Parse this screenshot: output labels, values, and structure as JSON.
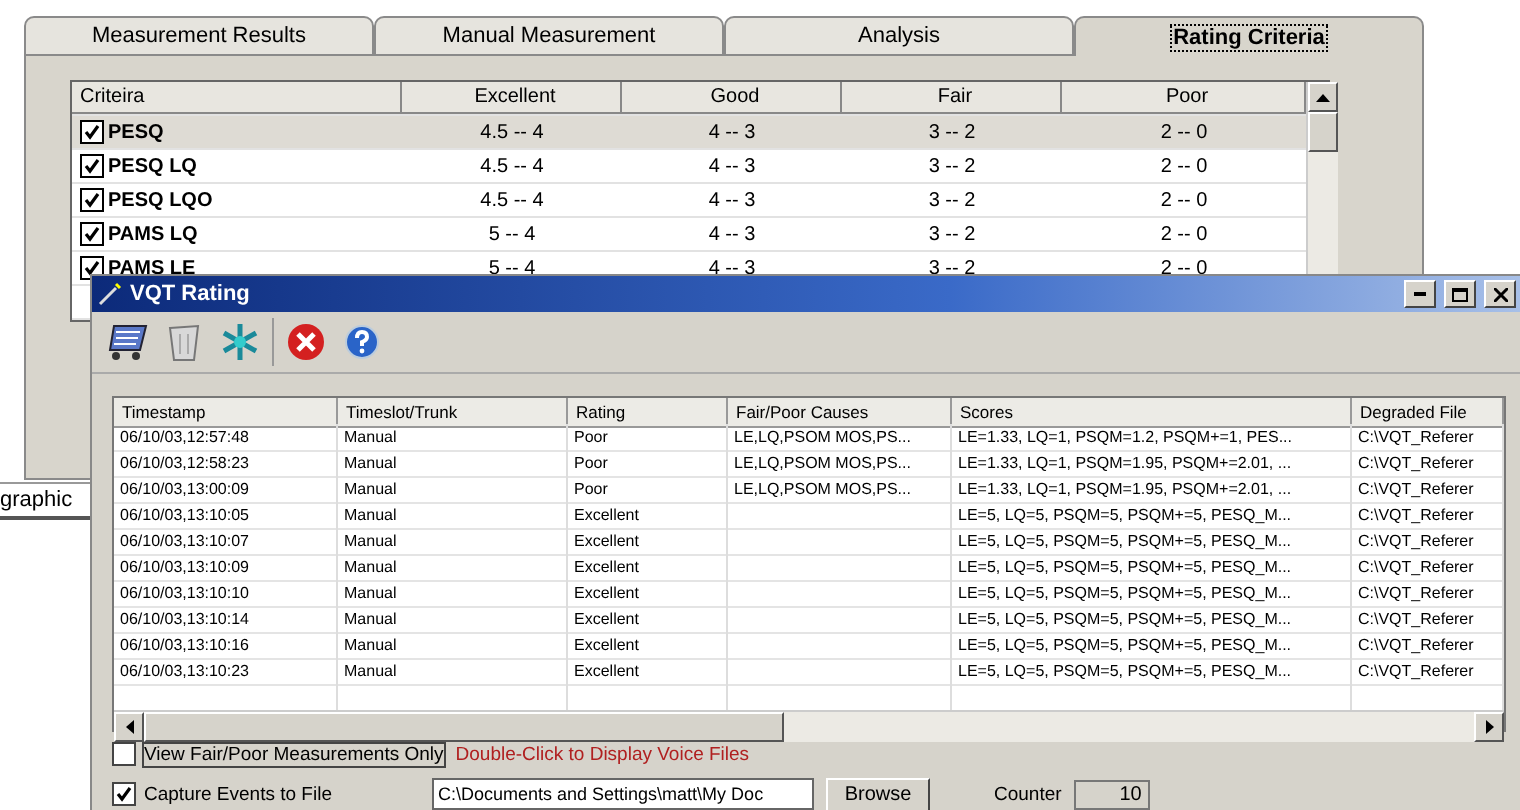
{
  "back_window": {
    "tabs": [
      {
        "label": "Measurement Results",
        "selected": false
      },
      {
        "label": "Manual Measurement",
        "selected": false
      },
      {
        "label": "Analysis",
        "selected": false
      },
      {
        "label": "Rating Criteria",
        "selected": true
      }
    ],
    "criteria_table": {
      "columns": [
        "Criteira",
        "Excellent",
        "Good",
        "Fair",
        "Poor"
      ],
      "rows": [
        {
          "checked": true,
          "selected": true,
          "cells": [
            "PESQ",
            "4.5 -- 4",
            "4 -- 3",
            "3 -- 2",
            "2 -- 0"
          ]
        },
        {
          "checked": true,
          "selected": false,
          "cells": [
            "PESQ LQ",
            "4.5 -- 4",
            "4 -- 3",
            "3 -- 2",
            "2 -- 0"
          ]
        },
        {
          "checked": true,
          "selected": false,
          "cells": [
            "PESQ LQO",
            "4.5 -- 4",
            "4 -- 3",
            "3 -- 2",
            "2 -- 0"
          ]
        },
        {
          "checked": true,
          "selected": false,
          "cells": [
            "PAMS LQ",
            "5 -- 4",
            "4 -- 3",
            "3 -- 2",
            "2 -- 0"
          ]
        },
        {
          "checked": true,
          "selected": false,
          "cells": [
            "PAMS LE",
            "5 -- 4",
            "4 -- 3",
            "3 -- 2",
            "2 -- 0"
          ]
        }
      ]
    },
    "status_text": "graphic"
  },
  "rating_window": {
    "title": "VQT Rating",
    "table": {
      "columns": [
        "Timestamp",
        "Timeslot/Trunk",
        "Rating",
        "Fair/Poor Causes",
        "Scores",
        "Degraded File"
      ],
      "rows": [
        [
          "06/10/03,12:57:48",
          "Manual",
          "Poor",
          "LE,LQ,PSOM MOS,PS...",
          "LE=1.33, LQ=1, PSQM=1.2, PSQM+=1, PES...",
          "C:\\VQT_Referer"
        ],
        [
          "06/10/03,12:58:23",
          "Manual",
          "Poor",
          "LE,LQ,PSOM MOS,PS...",
          "LE=1.33, LQ=1, PSQM=1.95, PSQM+=2.01, ...",
          "C:\\VQT_Referer"
        ],
        [
          "06/10/03,13:00:09",
          "Manual",
          "Poor",
          "LE,LQ,PSOM MOS,PS...",
          "LE=1.33, LQ=1, PSQM=1.95, PSQM+=2.01, ...",
          "C:\\VQT_Referer"
        ],
        [
          "06/10/03,13:10:05",
          "Manual",
          "Excellent",
          "",
          "LE=5, LQ=5, PSQM=5, PSQM+=5, PESQ_M...",
          "C:\\VQT_Referer"
        ],
        [
          "06/10/03,13:10:07",
          "Manual",
          "Excellent",
          "",
          "LE=5, LQ=5, PSQM=5, PSQM+=5, PESQ_M...",
          "C:\\VQT_Referer"
        ],
        [
          "06/10/03,13:10:09",
          "Manual",
          "Excellent",
          "",
          "LE=5, LQ=5, PSQM=5, PSQM+=5, PESQ_M...",
          "C:\\VQT_Referer"
        ],
        [
          "06/10/03,13:10:10",
          "Manual",
          "Excellent",
          "",
          "LE=5, LQ=5, PSQM=5, PSQM+=5, PESQ_M...",
          "C:\\VQT_Referer"
        ],
        [
          "06/10/03,13:10:14",
          "Manual",
          "Excellent",
          "",
          "LE=5, LQ=5, PSQM=5, PSQM+=5, PESQ_M...",
          "C:\\VQT_Referer"
        ],
        [
          "06/10/03,13:10:16",
          "Manual",
          "Excellent",
          "",
          "LE=5, LQ=5, PSQM=5, PSQM+=5, PESQ_M...",
          "C:\\VQT_Referer"
        ],
        [
          "06/10/03,13:10:23",
          "Manual",
          "Excellent",
          "",
          "LE=5, LQ=5, PSQM=5, PSQM+=5, PESQ_M...",
          "C:\\VQT_Referer"
        ]
      ]
    },
    "view_option": {
      "label": "View Fair/Poor Measurements Only",
      "checked": false
    },
    "hint": "Double-Click to Display Voice Files",
    "capture_option": {
      "label": "Capture Events to File",
      "checked": true
    },
    "file_field": {
      "value": "C:\\Documents and Settings\\matt\\My Doc"
    },
    "browse_button": "Browse",
    "counter": {
      "label": "Counter",
      "value": "10"
    }
  }
}
